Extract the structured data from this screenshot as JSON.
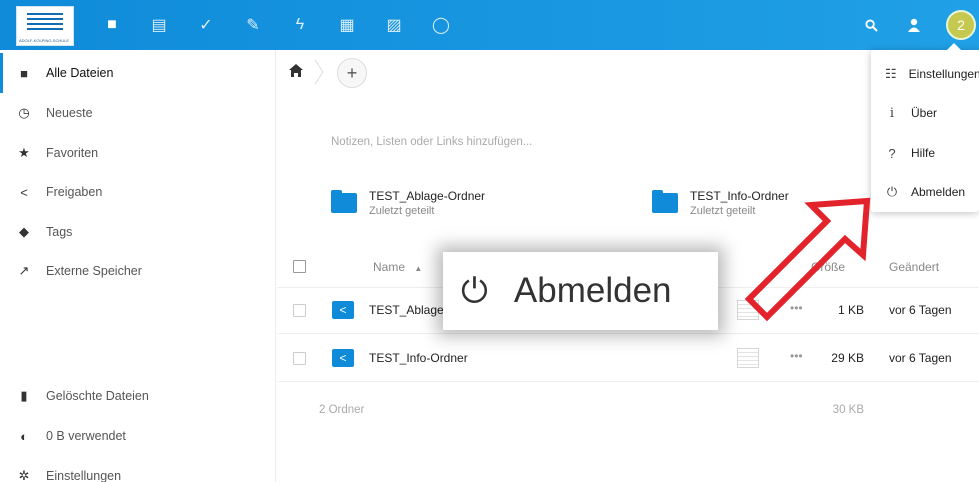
{
  "header": {
    "logo_caption": "ADOLF-KOLPING-SCHULE",
    "apps": [
      {
        "icon": "files-icon",
        "glyph": "■"
      },
      {
        "icon": "deck-icon",
        "glyph": "▤"
      },
      {
        "icon": "tasks-icon",
        "glyph": "✓"
      },
      {
        "icon": "notes-icon",
        "glyph": "✎"
      },
      {
        "icon": "activity-icon",
        "glyph": "ϟ"
      },
      {
        "icon": "calendar-icon",
        "glyph": "▦"
      },
      {
        "icon": "gallery-icon",
        "glyph": "▨"
      },
      {
        "icon": "talk-icon",
        "glyph": "◯"
      }
    ],
    "avatar_initial": "2"
  },
  "sidebar": {
    "items": [
      {
        "label": "Alle Dateien",
        "icon": "folder-icon"
      },
      {
        "label": "Neueste",
        "icon": "clock-icon"
      },
      {
        "label": "Favoriten",
        "icon": "star-icon"
      },
      {
        "label": "Freigaben",
        "icon": "share-icon"
      },
      {
        "label": "Tags",
        "icon": "tag-icon"
      },
      {
        "label": "Externe Speicher",
        "icon": "external-icon"
      }
    ],
    "bottom": [
      {
        "label": "Gelöschte Dateien",
        "icon": "trash-icon"
      },
      {
        "label": "0 B verwendet",
        "icon": "quota-icon"
      },
      {
        "label": "Einstellungen",
        "icon": "gear-icon"
      }
    ]
  },
  "content": {
    "add_label": "+",
    "notes_placeholder": "Notizen, Listen oder Links hinzufügen...",
    "recent": [
      {
        "name": "TEST_Ablage-Ordner",
        "sub": "Zuletzt geteilt"
      },
      {
        "name": "TEST_Info-Ordner",
        "sub": "Zuletzt geteilt"
      }
    ],
    "columns": {
      "name": "Name",
      "size": "Größe",
      "modified": "Geändert"
    },
    "rows": [
      {
        "name": "TEST_Ablage-Ordner",
        "size": "1 KB",
        "modified": "vor 6 Tagen"
      },
      {
        "name": "TEST_Info-Ordner",
        "size": "29 KB",
        "modified": "vor 6 Tagen"
      }
    ],
    "summary": {
      "count": "2 Ordner",
      "size": "30 KB"
    }
  },
  "menu": {
    "items": [
      {
        "label": "Einstellungen",
        "icon": "settings-list-icon"
      },
      {
        "label": "Über",
        "icon": "info-icon"
      },
      {
        "label": "Hilfe",
        "icon": "help-icon"
      },
      {
        "label": "Abmelden",
        "icon": "power-icon"
      }
    ]
  },
  "callout": {
    "label": "Abmelden"
  },
  "colors": {
    "accent": "#0f8bd9",
    "arrow": "#e3232c"
  }
}
